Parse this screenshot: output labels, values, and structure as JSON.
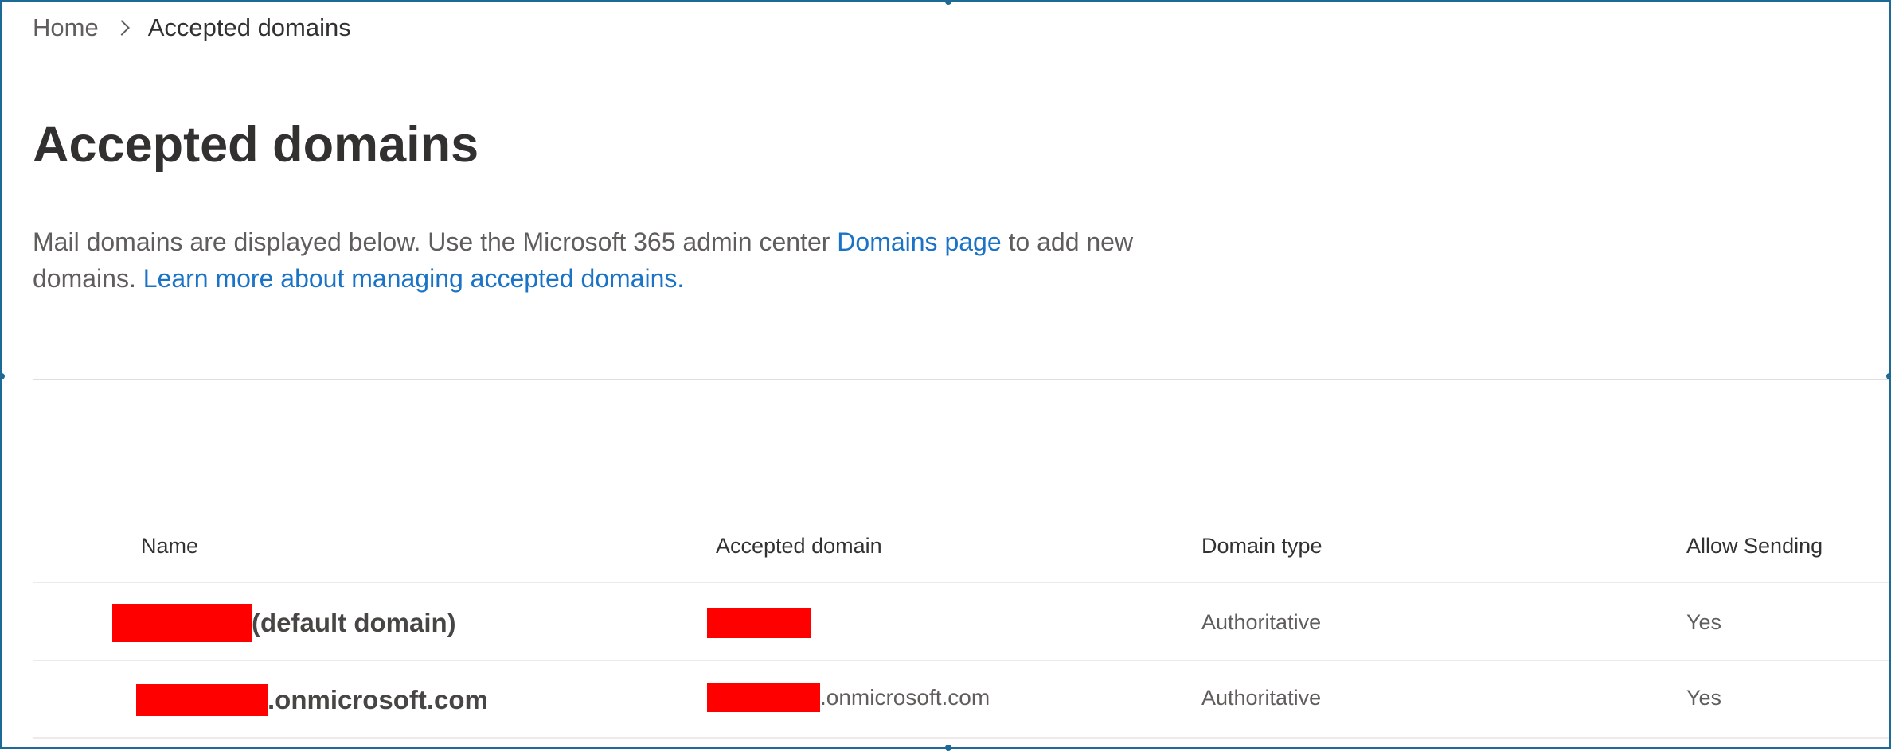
{
  "breadcrumb": {
    "home": "Home",
    "current": "Accepted domains"
  },
  "page": {
    "title": "Accepted domains",
    "description_prefix": "Mail domains are displayed below. Use the Microsoft 365 admin center ",
    "domains_link": "Domains page",
    "description_middle": " to add new domains. ",
    "learn_more_link": "Learn more about managing accepted domains."
  },
  "table": {
    "columns": {
      "name": "Name",
      "accepted_domain": "Accepted domain",
      "domain_type": "Domain type",
      "allow_sending": "Allow Sending"
    },
    "rows": [
      {
        "name_suffix": "(default domain)",
        "accepted_domain_suffix": "",
        "domain_type": "Authoritative",
        "allow_sending": "Yes"
      },
      {
        "name_suffix": ".onmicrosoft.com",
        "accepted_domain_suffix": ".onmicrosoft.com",
        "domain_type": "Authoritative",
        "allow_sending": "Yes"
      }
    ]
  },
  "colors": {
    "link": "#1a73c6",
    "frame_border": "#1d6a97",
    "redaction": "#ff0000"
  }
}
